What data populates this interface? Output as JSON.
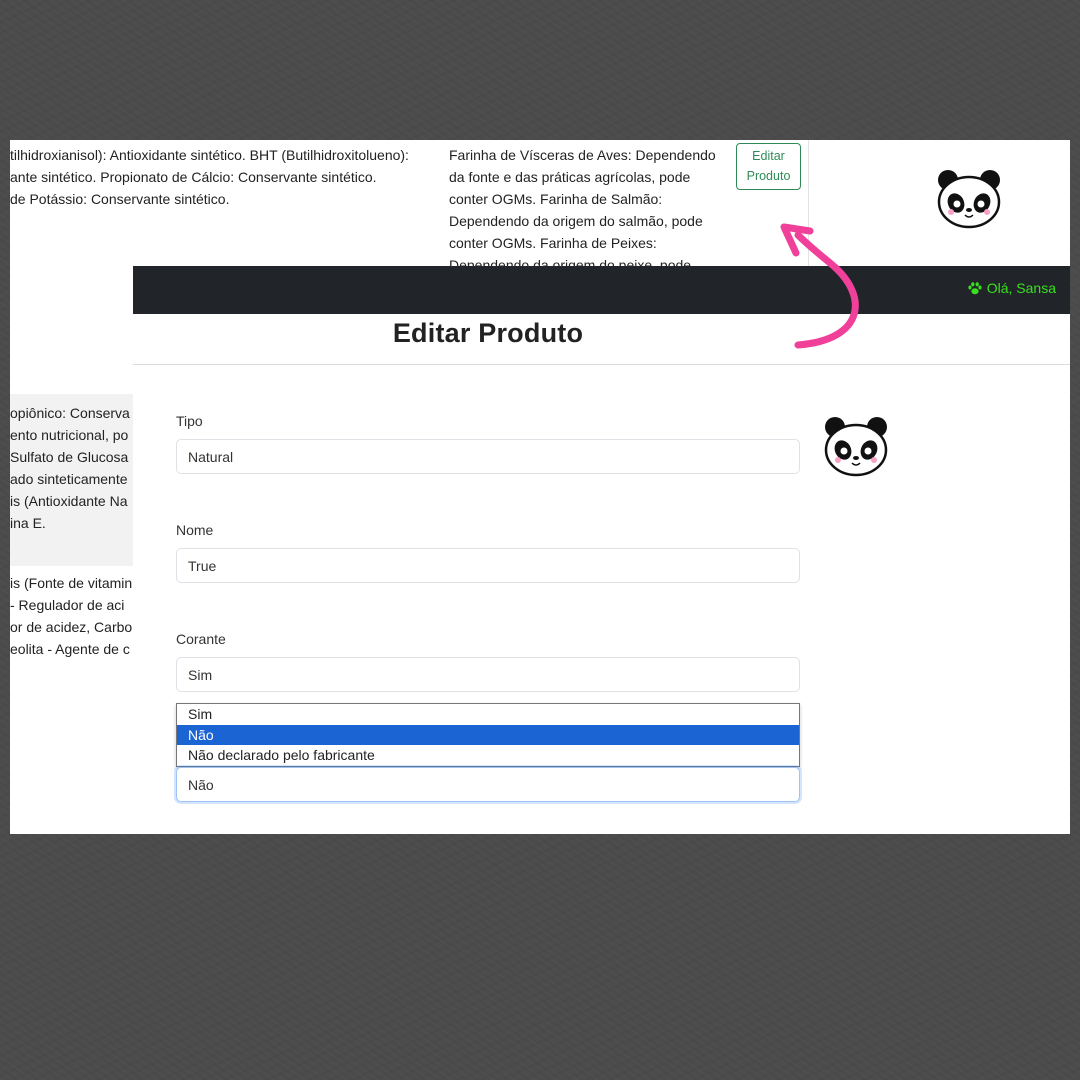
{
  "top_table": {
    "ingredients_lines": [
      "tilhidroxianisol): Antioxidante sintético. BHT (Butilhidroxitolueno):",
      "ante sintético. Propionato de Cálcio: Conservante sintético.",
      "de Potássio: Conservante sintético."
    ],
    "ogm_lines": [
      "Farinha de Vísceras de Aves: Dependendo",
      "da fonte e das práticas agrícolas, pode",
      "conter OGMs. Farinha de Salmão:",
      "Dependendo da origem do salmão, pode",
      "conter OGMs. Farinha de Peixes:",
      "Dependendo da origem do peixe, pode"
    ],
    "edit_button": {
      "line1": "Editar",
      "line2": "Produto"
    }
  },
  "left_strip": {
    "block_a": [
      "opiônico: Conserva",
      "ento nutricional, po",
      "Sulfato de Glucosa",
      "ado sinteticamente",
      "is (Antioxidante Na",
      "ina E."
    ],
    "block_b": [
      "is (Fonte de vitamin",
      "- Regulador de aci",
      "or de acidez, Carbo",
      "eolita - Agente de c"
    ]
  },
  "navbar": {
    "greeting": "Olá, Sansa",
    "greeting_color": "#39e01f"
  },
  "form": {
    "title": "Editar Produto",
    "fields": [
      {
        "label": "Tipo",
        "value": "Natural"
      },
      {
        "label": "Nome",
        "value": "True"
      },
      {
        "label": "Corante",
        "value": "Sim"
      }
    ],
    "dropdown_options": [
      "Sim",
      "Não",
      "Não declarado pelo fabricante"
    ],
    "dropdown_selected": "Não",
    "active_select_value": "Não"
  },
  "colors": {
    "background": "#4b4b4b",
    "navbar": "#212529",
    "selected_option": "#1a64d4",
    "edit_button": "#2e8b57",
    "arrow": "#f0409a"
  }
}
